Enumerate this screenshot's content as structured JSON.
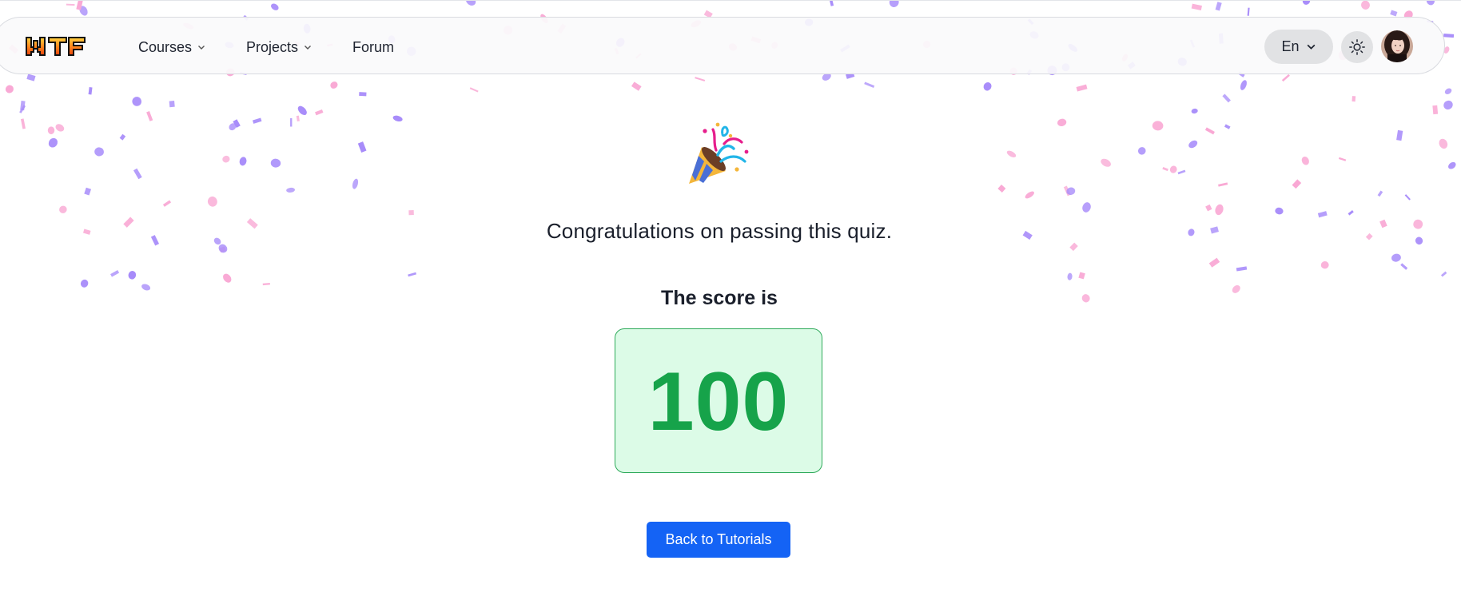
{
  "header": {
    "logo_text": "WTF",
    "nav": {
      "courses_label": "Courses",
      "projects_label": "Projects",
      "forum_label": "Forum"
    },
    "language_label": "En",
    "theme_icon": "sun-icon",
    "avatar_icon": "user-avatar"
  },
  "main": {
    "celebration_icon": "party-popper-icon",
    "congrats_text": "Congratulations on passing this quiz.",
    "score_label": "The score is",
    "score_value": "100",
    "back_button_label": "Back to Tutorials"
  },
  "colors": {
    "score_text": "#16a34a",
    "score_bg": "#dcfbe7",
    "score_border": "#2eaa5a",
    "primary_button": "#1463f5",
    "confetti_purple": "#a78bfa",
    "confetti_pink": "#f9a8d4"
  }
}
